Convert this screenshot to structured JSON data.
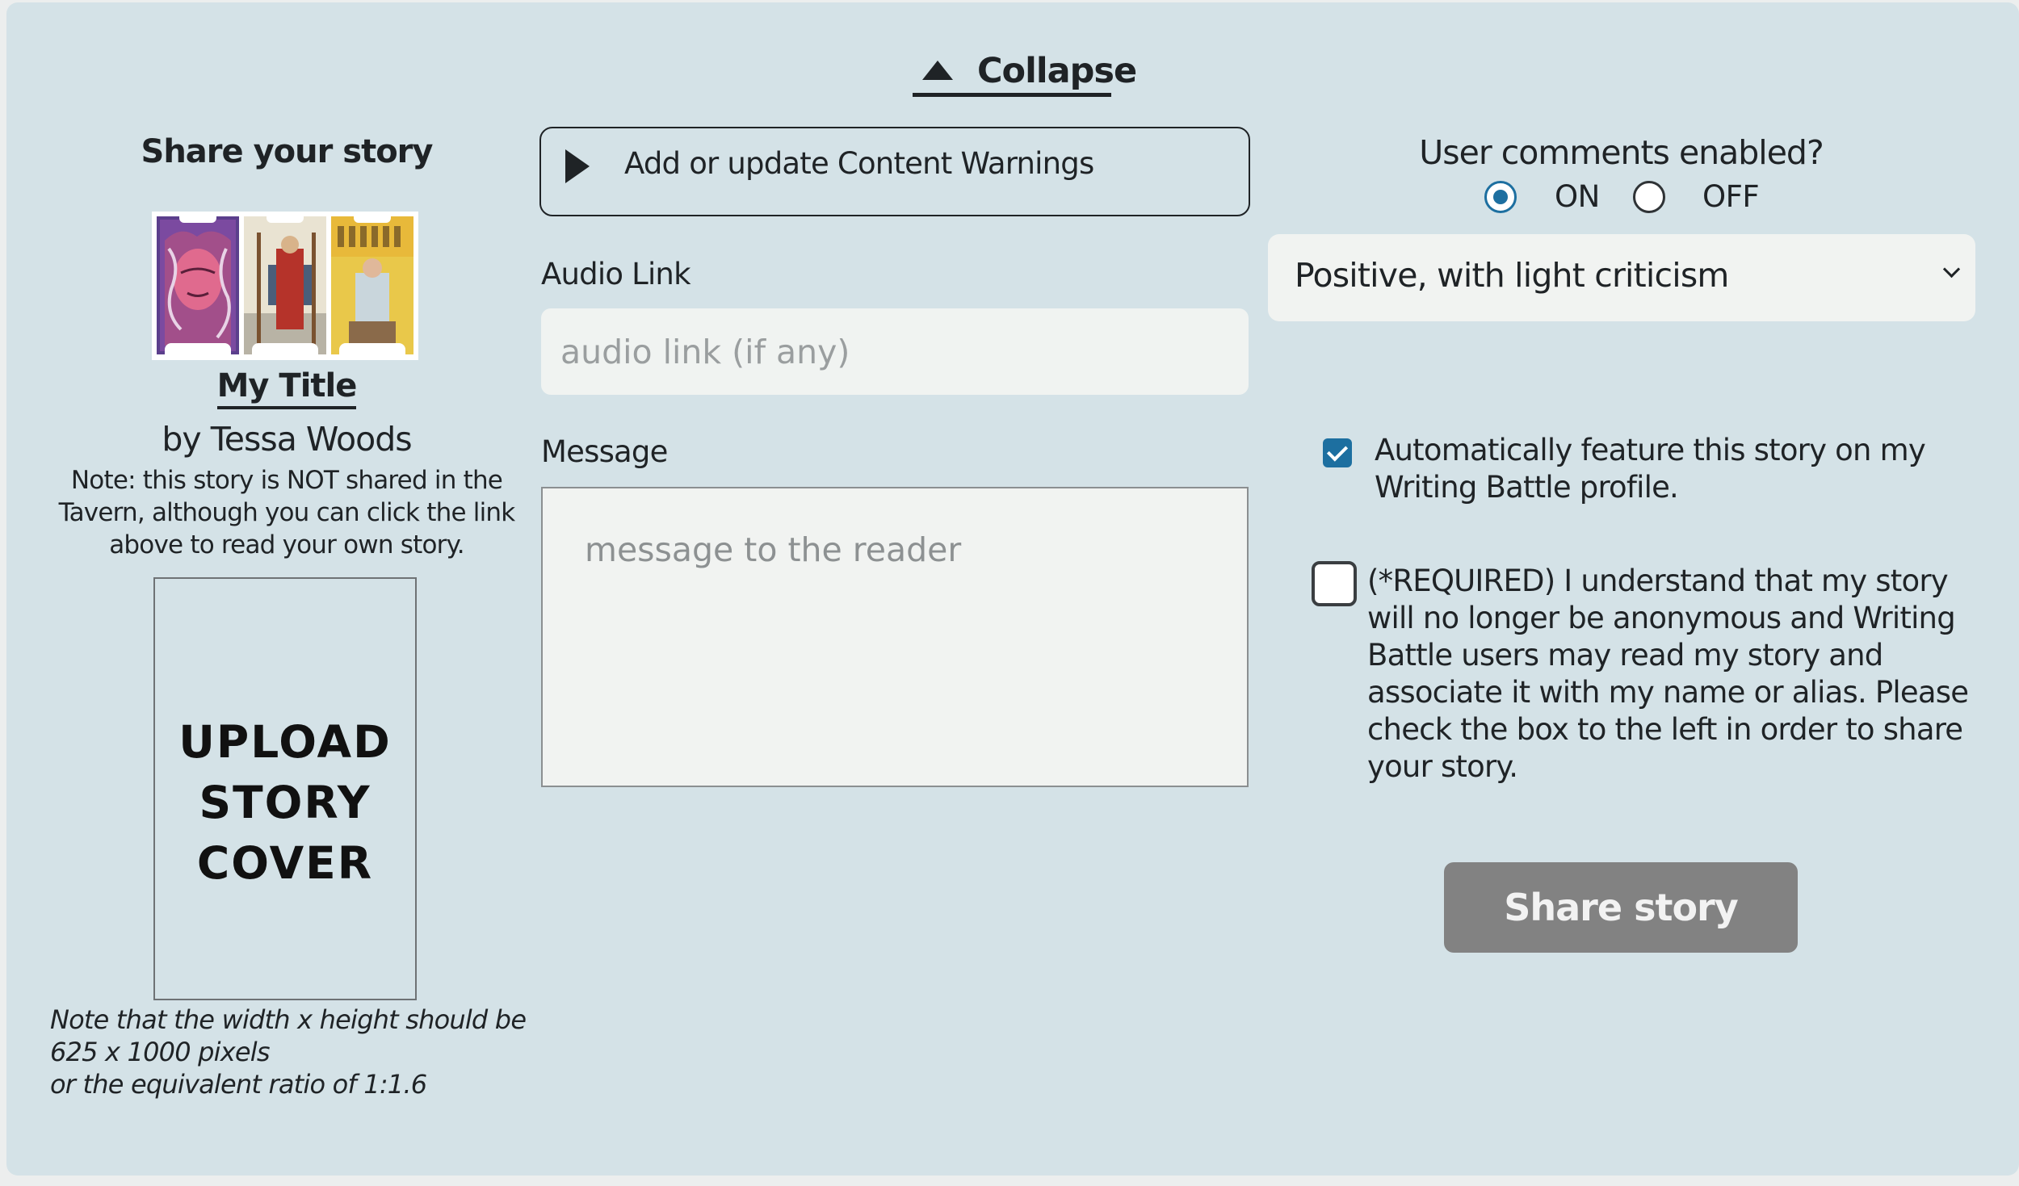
{
  "collapse": {
    "label": "Collapse",
    "icon": "triangle-up-icon"
  },
  "left": {
    "heading": "Share your story",
    "story_title": "My Title",
    "author": "by Tessa Woods",
    "note": "Note: this story is NOT shared in the Tavern, although you can click the link above to read your own story.",
    "upload_lines": [
      "UPLOAD",
      "STORY",
      "COVER"
    ],
    "dimension_note": [
      "Note that the width x height should be",
      "625 x 1000 pixels",
      "or the equivalent ratio of 1:1.6"
    ]
  },
  "middle": {
    "content_warnings_label": "Add or update Content Warnings",
    "audio_label": "Audio Link",
    "audio_placeholder": "audio link (if any)",
    "audio_value": "",
    "message_label": "Message",
    "message_placeholder": "message to the reader",
    "message_value": ""
  },
  "right": {
    "comments_question": "User comments enabled?",
    "on_label": "ON",
    "off_label": "OFF",
    "comments_selected": "ON",
    "feedback_selected": "Positive, with light criticism",
    "feature_checked": true,
    "feature_text": [
      "Automatically feature this story on my",
      "Writing Battle profile."
    ],
    "required_checked": false,
    "required_text": [
      "(*REQUIRED) I understand that my story",
      "will no longer be anonymous and Writing",
      "Battle users may read my story and",
      "associate it with my name or alias. Please",
      "check the box to the left in order to share",
      "your story."
    ],
    "share_button": "Share story"
  },
  "colors": {
    "panel": "#d4e2e7",
    "accent": "#1d6fa0",
    "share_button_bg": "#828282"
  }
}
